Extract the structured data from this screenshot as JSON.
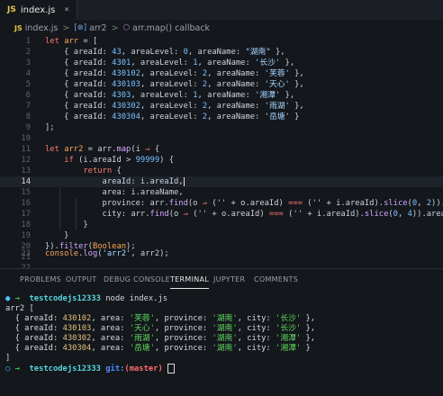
{
  "tab": {
    "badge": "JS",
    "name": "index.js",
    "close": "×"
  },
  "breadcrumb": {
    "file_badge": "JS",
    "file": "index.js",
    "sep": ">",
    "var_icon": "[⊗]",
    "var": "arr2",
    "fn_icon": "⬡",
    "fn": "arr.map() callback"
  },
  "editor": {
    "active_line": 14,
    "lines": [
      {
        "n": "1"
      },
      {
        "n": "2"
      },
      {
        "n": "3"
      },
      {
        "n": "4"
      },
      {
        "n": "5"
      },
      {
        "n": "6"
      },
      {
        "n": "7"
      },
      {
        "n": "8"
      },
      {
        "n": "9"
      },
      {
        "n": "10"
      },
      {
        "n": "11"
      },
      {
        "n": "12"
      },
      {
        "n": "13"
      },
      {
        "n": "14"
      },
      {
        "n": "15"
      },
      {
        "n": "16"
      },
      {
        "n": "17"
      },
      {
        "n": "18"
      },
      {
        "n": "19"
      },
      {
        "n": "20"
      },
      {
        "n": "21"
      },
      {
        "n": "22"
      },
      {
        "n": "23"
      }
    ]
  },
  "panel": {
    "tabs": [
      "PROBLEMS",
      "OUTPUT",
      "DEBUG CONSOLE",
      "TERMINAL",
      "JUPYTER",
      "COMMENTS"
    ],
    "active_tab": "TERMINAL"
  },
  "terminal": {
    "dir": "testcodejs12333",
    "command": "node index.js",
    "output_header": "arr2 [",
    "rows": [
      {
        "areaId": "430102",
        "area": "'芙蓉'",
        "province": "'湖南'",
        "city": "'长沙'"
      },
      {
        "areaId": "430103",
        "area": "'天心'",
        "province": "'湖南'",
        "city": "'长沙'"
      },
      {
        "areaId": "430302",
        "area": "'雨湖'",
        "province": "'湖南'",
        "city": "'湘潭'"
      },
      {
        "areaId": "430304",
        "area": "'岳塘'",
        "province": "'湖南'",
        "city": "'湘潭'"
      }
    ],
    "output_footer": "]",
    "git_label": "git:",
    "branch": "(master)"
  },
  "colors": {
    "background": "#14171c",
    "keyword": "#ff7b72",
    "string": "#a5d6ff",
    "number": "#79c0ff"
  }
}
